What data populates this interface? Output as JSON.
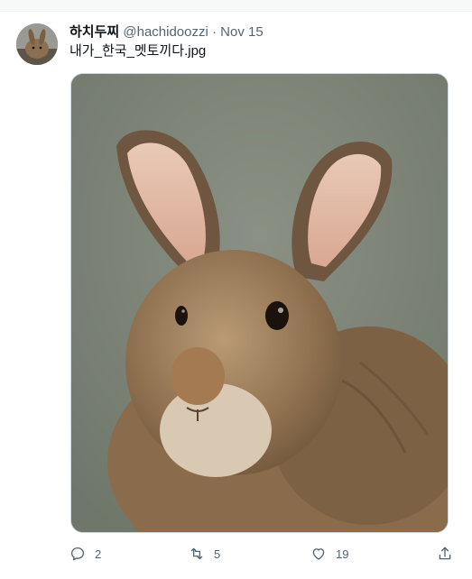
{
  "tweet": {
    "display_name": "하치두찌",
    "handle": "@hachidoozzi",
    "separator": "·",
    "date": "Nov 15",
    "text": "내가_한국_멧토끼다.jpg",
    "media": {
      "subject": "wild rabbit portrait",
      "background_color": "#7d8577"
    }
  },
  "actions": {
    "reply": {
      "icon": "reply-icon",
      "count": "2"
    },
    "retweet": {
      "icon": "retweet-icon",
      "count": "5"
    },
    "like": {
      "icon": "heart-icon",
      "count": "19"
    },
    "share": {
      "icon": "share-icon"
    }
  },
  "colors": {
    "text_primary": "#0f1419",
    "text_secondary": "#536471",
    "border": "#cfd9de"
  }
}
